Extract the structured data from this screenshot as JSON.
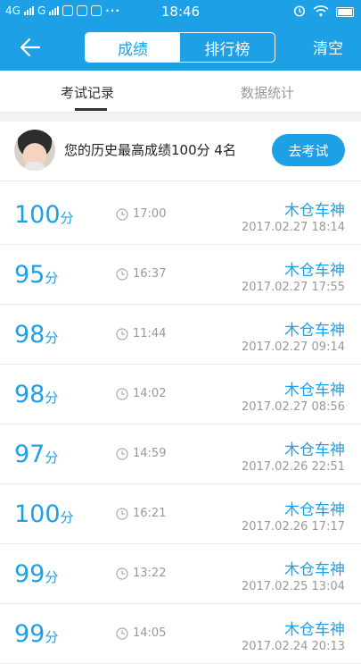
{
  "status_bar": {
    "network1": "4G",
    "network2": "G",
    "time": "18:46",
    "dots": "···"
  },
  "header": {
    "tabs": [
      {
        "label": "成绩",
        "active": true
      },
      {
        "label": "排行榜",
        "active": false
      }
    ],
    "clear_label": "清空"
  },
  "subtabs": [
    "考试记录",
    "数据统计"
  ],
  "summary": {
    "text": "您的历史最高成绩100分  4名",
    "button_label": "去考试"
  },
  "records": [
    {
      "score": "100",
      "unit": "分",
      "duration": "17:00",
      "name": "木仓车神",
      "date": "2017.02.27  18:14"
    },
    {
      "score": "95",
      "unit": "分",
      "duration": "16:37",
      "name": "木仓车神",
      "date": "2017.02.27  17:55"
    },
    {
      "score": "98",
      "unit": "分",
      "duration": "11:44",
      "name": "木仓车神",
      "date": "2017.02.27  09:14"
    },
    {
      "score": "98",
      "unit": "分",
      "duration": "14:02",
      "name": "木仓车神",
      "date": "2017.02.27  08:56"
    },
    {
      "score": "97",
      "unit": "分",
      "duration": "14:59",
      "name": "木仓车神",
      "date": "2017.02.26  22:51"
    },
    {
      "score": "100",
      "unit": "分",
      "duration": "16:21",
      "name": "木仓车神",
      "date": "2017.02.26  17:17"
    },
    {
      "score": "99",
      "unit": "分",
      "duration": "13:22",
      "name": "木仓车神",
      "date": "2017.02.25  13:04"
    },
    {
      "score": "99",
      "unit": "分",
      "duration": "14:05",
      "name": "木仓车神",
      "date": "2017.02.24  20:13"
    }
  ],
  "colors": {
    "accent": "#1ea0e6"
  }
}
